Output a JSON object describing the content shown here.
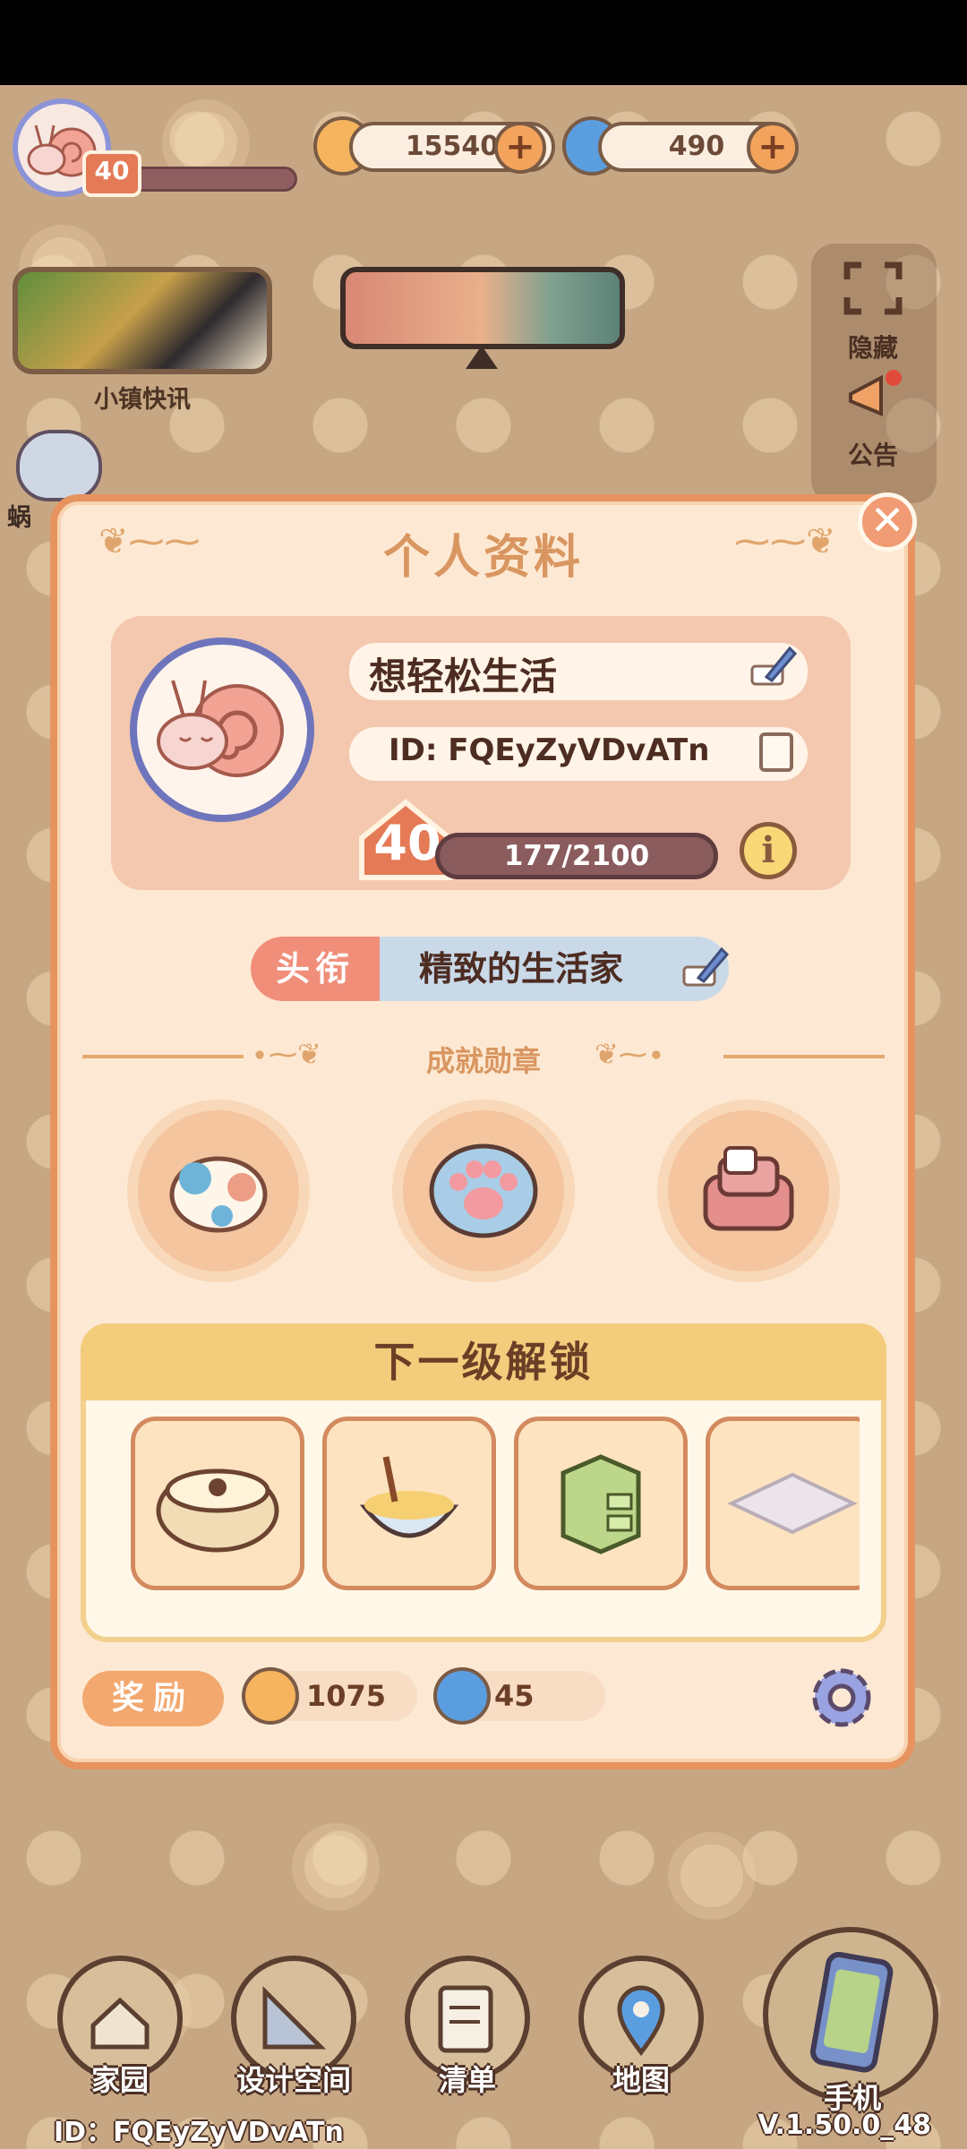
{
  "hud": {
    "level": "40",
    "coins": "15540",
    "gems": "490",
    "plus": "+",
    "news_label": "小镇快讯",
    "side_hide": "隐藏",
    "side_notice": "公告",
    "snail_label": "蜗"
  },
  "profile": {
    "title": "个人资料",
    "close": "✕",
    "name": "想轻松生活",
    "id": "ID: FQEyZyVDvATn",
    "level": "40",
    "xp": "177/2100",
    "info": "i",
    "rank_label": "头衔",
    "rank_value": "精致的生活家",
    "achievements_label": "成就勋章",
    "unlock_title": "下一级解锁",
    "reward_label": "奖励",
    "reward_coins": "1075",
    "reward_gems": "45"
  },
  "nav": {
    "home": "家园",
    "design": "设计空间",
    "list": "清单",
    "map": "地图",
    "phone": "手机"
  },
  "footer": {
    "id": "ID：FQEyZyVDvATn",
    "version": "V.1.50.0_48"
  },
  "colors": {
    "modal_border": "#e79360",
    "modal_bg": "#fde9d3",
    "title": "#d99661",
    "xp_bar": "#8a5c5e"
  }
}
